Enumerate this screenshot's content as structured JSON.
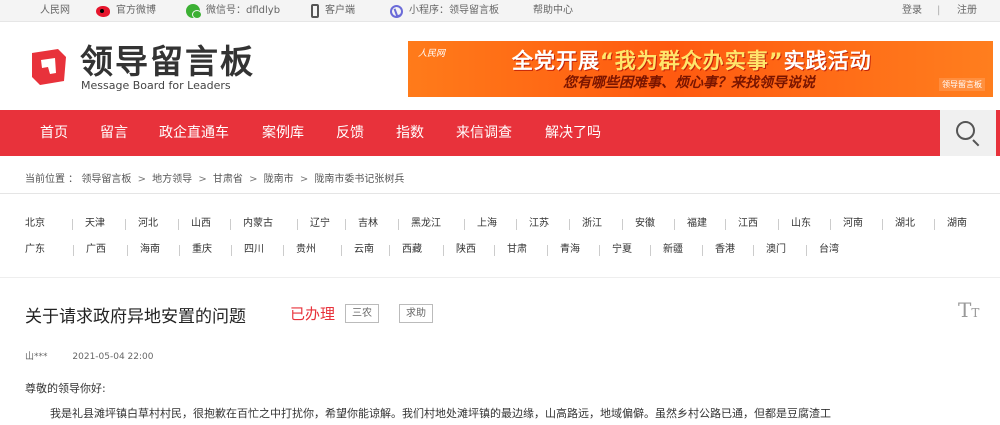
{
  "topbar": {
    "people_site": "人民网",
    "weibo": "官方微博",
    "wechat": "微信号：dfldlyb",
    "client": "客户端",
    "mini_program": "小程序：领导留言板",
    "help": "帮助中心",
    "login": "登录",
    "divider": "|",
    "register": "注册"
  },
  "header": {
    "logo_cn": "领导留言板",
    "logo_en": "Message Board for Leaders",
    "banner": {
      "logo_text": "人民网",
      "title_pre": "全党开展",
      "title_quote": "“我为群众办实事”",
      "title_post": "实践活动",
      "subtitle": "您有哪些困难事、烦心事？来找领导说说",
      "corner": "领导留言板"
    }
  },
  "nav": {
    "items": [
      "首页",
      "留言",
      "政企直通车",
      "案例库",
      "反馈",
      "指数",
      "来信调查",
      "解决了吗"
    ]
  },
  "breadcrumb": {
    "prefix": "当前位置 ：",
    "items": [
      "领导留言板",
      "地方领导",
      "甘肃省",
      "陇南市",
      "陇南市委书记张树兵"
    ],
    "sep": ">"
  },
  "provinces": {
    "row1": [
      "北京",
      "天津",
      "河北",
      "山西",
      "内蒙古",
      "辽宁",
      "吉林",
      "黑龙江",
      "上海",
      "江苏",
      "浙江",
      "安徽",
      "福建",
      "江西",
      "山东",
      "河南",
      "湖北",
      "湖南"
    ],
    "row2": [
      "广东",
      "广西",
      "海南",
      "重庆",
      "四川",
      "贵州",
      "云南",
      "西藏",
      "陕西",
      "甘肃",
      "青海",
      "宁夏",
      "新疆",
      "香港",
      "澳门",
      "台湾"
    ]
  },
  "article": {
    "title": "关于请求政府异地安置的问题",
    "status": "已办理",
    "tags": [
      "三农",
      "求助"
    ],
    "font_toggle": "T",
    "author": "山***",
    "date": "2021-05-04 22:00",
    "greeting": "尊敬的领导你好:",
    "body": "我是礼县滩坪镇白草村村民，很抱歉在百忙之中打扰你，希望你能谅解。我们村地处滩坪镇的最边缘，山高路远，地域偏僻。虽然乡村公路已通，但都是豆腐渣工"
  },
  "colors": {
    "brand_red": "#e8323b",
    "banner_orange": "#ff5a10"
  }
}
